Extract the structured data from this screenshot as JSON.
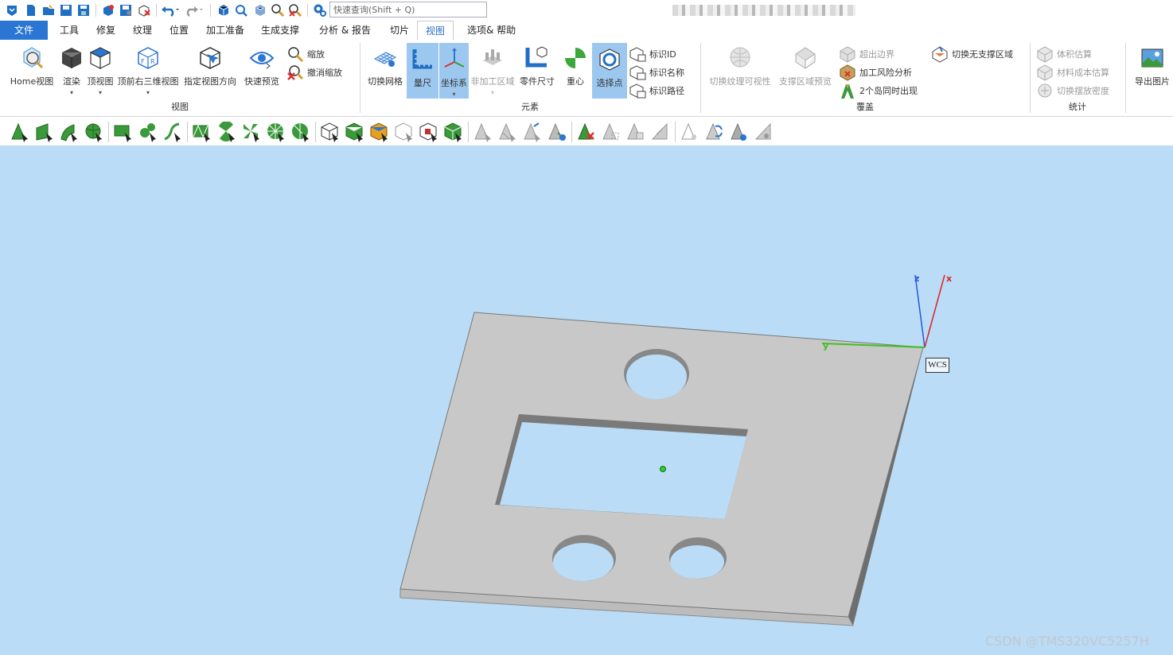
{
  "search": {
    "placeholder": "快速查询(Shift + Q)"
  },
  "menu": {
    "file": "文件",
    "tabs": [
      "工具",
      "修复",
      "纹理",
      "位置",
      "加工准备",
      "生成支撑",
      "分析 & 报告",
      "切片",
      "视图",
      "选项& 帮助"
    ],
    "active": "视图"
  },
  "ribbon": {
    "view": {
      "home": "Home视图",
      "render": "渲染",
      "top": "顶视图",
      "front_right_3d": "顶前右三维视图",
      "set_direction": "指定视图方向",
      "quick_preview": "快速预览",
      "zoom": "缩放",
      "undo_zoom": "撤消缩放",
      "group": "视图"
    },
    "elements": {
      "toggle_mesh": "切换网格",
      "ruler": "量尺",
      "coord": "坐标系",
      "non_machining": "非加工区域",
      "part_size": "零件尺寸",
      "center": "重心",
      "select_point": "选择点",
      "mark_id": "标识ID",
      "mark_name": "标识名称",
      "mark_path": "标识路径",
      "group": "元素"
    },
    "overlay": {
      "toggle_texture": "切换纹理可视性",
      "support_preview": "支撑区域预览",
      "out_of_bounds": "超出边界",
      "risk_analysis": "加工风险分析",
      "two_islands": "2个岛同时出现",
      "toggle_no_support": "切换无支撑区域",
      "group": "覆盖"
    },
    "stats": {
      "volume": "体积估算",
      "material_cost": "材料成本估算",
      "toggle_density": "切换摆放密度",
      "group": "统计"
    },
    "export": {
      "image": "导出图片"
    }
  },
  "viewport": {
    "wcs_label": "WCS",
    "axis_x": "x",
    "axis_y": "y",
    "axis_z": "z",
    "watermark": "CSDN @TMS320VC5257H"
  }
}
